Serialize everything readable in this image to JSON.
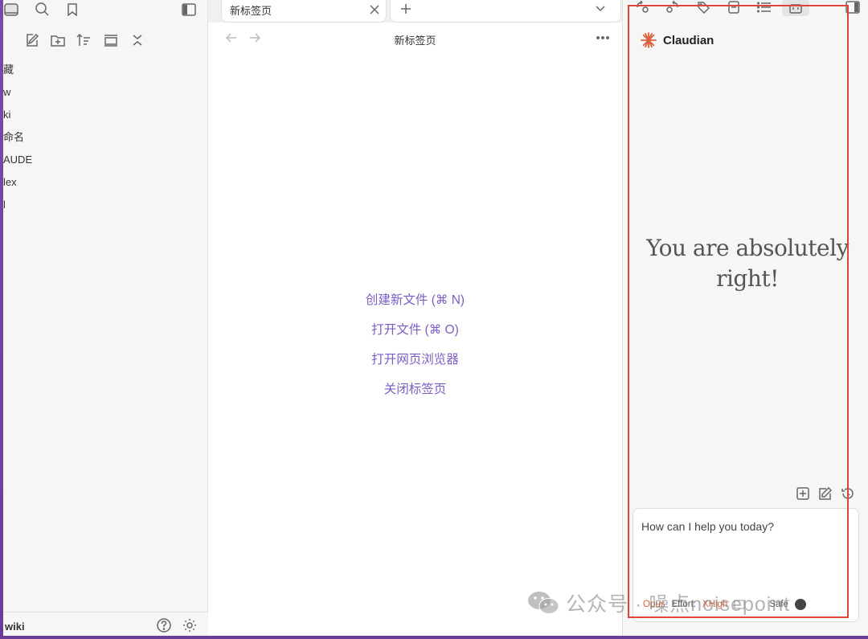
{
  "sidebar": {
    "tree_items": [
      "藏",
      "w",
      "ki",
      "命名",
      "AUDE",
      "lex",
      "l"
    ],
    "vault_name": "wiki"
  },
  "tabs": {
    "active_title": "新标签页"
  },
  "navbar": {
    "title": "新标签页"
  },
  "empty_state": {
    "actions": [
      "创建新文件 (⌘ N)",
      "打开文件 (⌘ O)",
      "打开网页浏览器",
      "关闭标签页"
    ]
  },
  "claudian": {
    "title": "Claudian",
    "hero_line1": "You are absolutely",
    "hero_line2": "right!",
    "input_placeholder": "How can I help you today?",
    "model": "Opus",
    "effort_label": "Effort:",
    "effort_value": "XHigh",
    "mode": "Safe",
    "accent": "#d8603c",
    "highlight_color": "#d9473b"
  },
  "watermark": {
    "text": "公众号 · 噪点noisepoint"
  }
}
